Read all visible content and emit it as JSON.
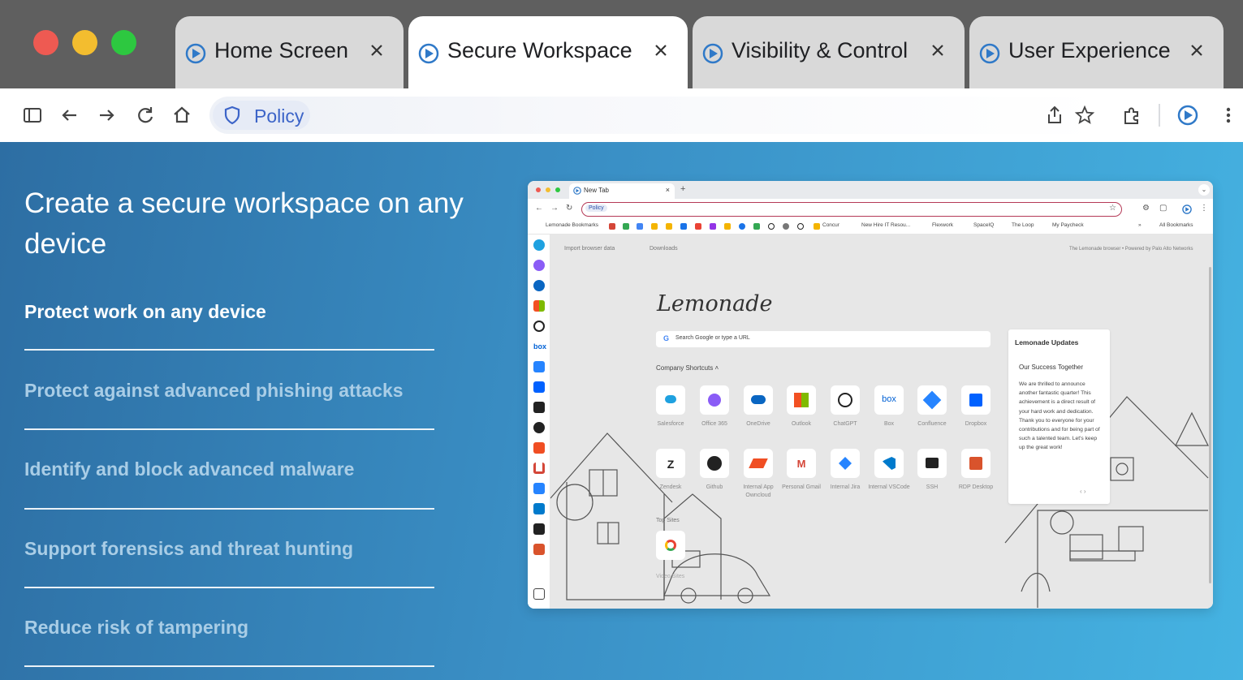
{
  "window": {
    "tabs": [
      {
        "label": "Home Screen",
        "active": false
      },
      {
        "label": "Secure Workspace",
        "active": true
      },
      {
        "label": "Visibility & Control",
        "active": false
      },
      {
        "label": "User Experience",
        "active": false
      }
    ]
  },
  "toolbar": {
    "policy_label": "Policy",
    "icons": [
      "sidebar-icon",
      "back-icon",
      "forward-icon",
      "reload-icon",
      "home-icon",
      "share-icon",
      "star-icon",
      "extensions-icon",
      "profile-icon",
      "menu-icon"
    ]
  },
  "main": {
    "headline": "Create a secure workspace on any device",
    "features": [
      {
        "label": "Protect work on any device",
        "active": true
      },
      {
        "label": "Protect against advanced phishing attacks",
        "active": false
      },
      {
        "label": "Identify and block advanced malware",
        "active": false
      },
      {
        "label": "Support forensics and threat hunting",
        "active": false
      },
      {
        "label": "Reduce risk of tampering",
        "active": false
      }
    ]
  },
  "inner_browser": {
    "tab_label": "New Tab",
    "tab_close": "×",
    "new_tab_symbol": "+",
    "chevron": "⌄",
    "omnibox_policy": "Policy",
    "bookmarks": [
      "Lemonade Bookmarks",
      "Concur",
      "New Hire IT Resou...",
      "Flexwork",
      "SpaceIQ",
      "The Loop",
      "My Paycheck",
      "»",
      "All Bookmarks"
    ],
    "top_links": {
      "import": "Import browser data",
      "downloads": "Downloads",
      "powered": "The Lemonade browser • Powered by Palo Alto Networks"
    },
    "brand": "Lemonade",
    "search_placeholder": "Search Google or type a URL",
    "company_shortcuts_title": "Company Shortcuts",
    "shortcuts_row1": [
      "Salesforce",
      "Office 365",
      "OneDrive",
      "Outlook",
      "ChatGPT",
      "Box",
      "Confluence",
      "Dropbox"
    ],
    "shortcuts_row2": [
      "Zendesk",
      "Github",
      "Internal App Owncloud",
      "Personal Gmail",
      "Internal Jira",
      "Internal VSCode",
      "SSH",
      "RDP Desktop"
    ],
    "top_sites_title": "Top Sites",
    "top_site_label": "Video Sites",
    "updates": {
      "title": "Lemonade Updates",
      "subtitle": "Our Success Together",
      "body": "We are thrilled to announce another fantastic quarter! This achievement is a direct result of your hard work and dedication. Thank you to everyone for your contributions and for being part of such a talented team. Let's keep up the great work!",
      "nav": "‹  ›"
    }
  },
  "colors": {
    "accent": "#3c64c8",
    "gradient_start": "#2d6ea3",
    "gradient_end": "#45b3e2",
    "inactive_feature": "#a9cde6",
    "omnibox_border": "#b53a57"
  }
}
